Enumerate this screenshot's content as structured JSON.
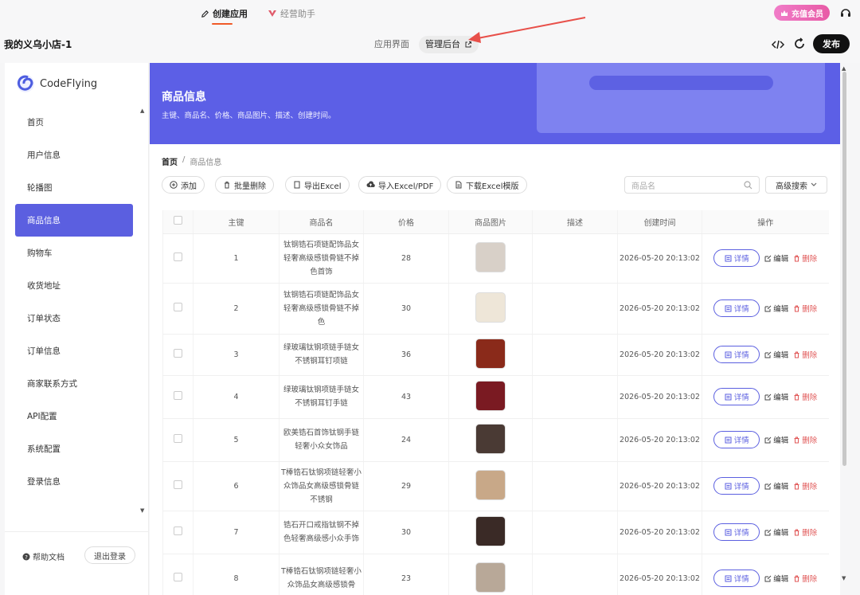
{
  "topbar": {
    "tab_create": "创建应用",
    "tab_ops": "经营助手",
    "store_name": "我的义乌小店-1",
    "view_app": "应用界面",
    "view_admin": "管理后台",
    "recharge": "充值会员",
    "publish": "发布"
  },
  "sidebar": {
    "logo": "CodeFlying",
    "items": [
      {
        "label": "首页"
      },
      {
        "label": "用户信息"
      },
      {
        "label": "轮播图"
      },
      {
        "label": "商品信息"
      },
      {
        "label": "购物车"
      },
      {
        "label": "收货地址"
      },
      {
        "label": "订单状态"
      },
      {
        "label": "订单信息"
      },
      {
        "label": "商家联系方式"
      },
      {
        "label": "API配置"
      },
      {
        "label": "系统配置"
      },
      {
        "label": "登录信息"
      }
    ],
    "active_index": 3,
    "help": "帮助文档",
    "logout": "退出登录"
  },
  "banner": {
    "title": "商品信息",
    "subtitle": "主键、商品名、价格、商品图片、描述、创建时间。"
  },
  "breadcrumb": {
    "home": "首页",
    "sep": "/",
    "current": "商品信息"
  },
  "toolbar": {
    "add": "添加",
    "batch_delete": "批量删除",
    "export_excel": "导出Excel",
    "import": "导入Excel/PDF",
    "download_template": "下载Excel模版",
    "search_placeholder": "商品名",
    "advanced": "高级搜索"
  },
  "table": {
    "headers": [
      "主键",
      "商品名",
      "价格",
      "商品图片",
      "描述",
      "创建时间",
      "操作"
    ],
    "detail_label": "详情",
    "edit_label": "编辑",
    "delete_label": "删除",
    "rows": [
      {
        "id": "1",
        "name": "钛钢锆石项链配饰品女轻奢高级感锁骨链不掉色首饰",
        "price": "28",
        "desc": "",
        "created": "2026-05-20 20:13:02",
        "img_color": "#d8d0c8"
      },
      {
        "id": "2",
        "name": "钛钢锆石项链配饰品女轻奢高级感锁骨链不掉色",
        "price": "30",
        "desc": "",
        "created": "2026-05-20 20:13:02",
        "img_color": "#eee6d8"
      },
      {
        "id": "3",
        "name": "绿玻璃钛钢项链手链女不锈钢耳钉项链",
        "price": "36",
        "desc": "",
        "created": "2026-05-20 20:13:02",
        "img_color": "#8a2a1a"
      },
      {
        "id": "4",
        "name": "绿玻璃钛钢项链手链女不锈钢耳钉手链",
        "price": "43",
        "desc": "",
        "created": "2026-05-20 20:13:02",
        "img_color": "#7a1a22"
      },
      {
        "id": "5",
        "name": "欧美锆石首饰钛钢手链轻奢小众女饰品",
        "price": "24",
        "desc": "",
        "created": "2026-05-20 20:13:02",
        "img_color": "#4a3a34"
      },
      {
        "id": "6",
        "name": "T棒锆石钛钢项链轻奢小众饰品女高级感锁骨链不锈钢",
        "price": "29",
        "desc": "",
        "created": "2026-05-20 20:13:02",
        "img_color": "#c8a888"
      },
      {
        "id": "7",
        "name": "锆石开口戒指钛钢不掉色轻奢高级感小众手饰",
        "price": "30",
        "desc": "",
        "created": "2026-05-20 20:13:02",
        "img_color": "#3a2a26"
      },
      {
        "id": "8",
        "name": "T棒锆石钛钢项链轻奢小众饰品女高级感锁骨",
        "price": "23",
        "desc": "",
        "created": "2026-05-20 20:13:02",
        "img_color": "#b8a898"
      }
    ]
  }
}
